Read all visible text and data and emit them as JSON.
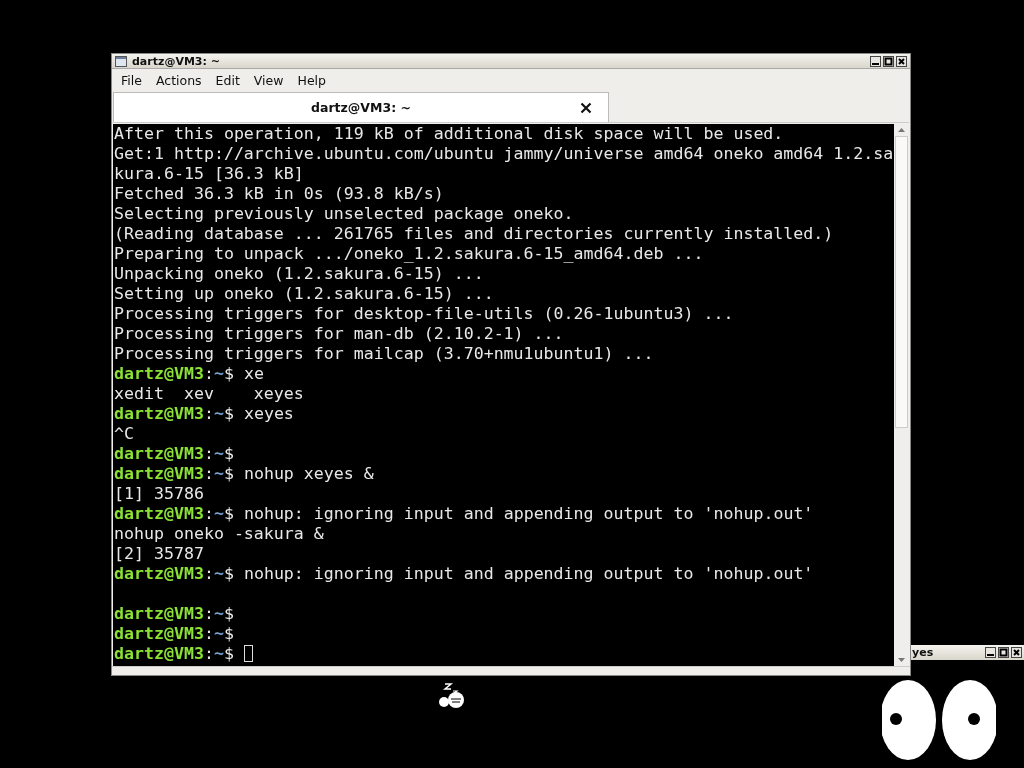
{
  "terminal_window": {
    "title": "dartz@VM3: ~",
    "menu": [
      "File",
      "Actions",
      "Edit",
      "View",
      "Help"
    ],
    "tabs": [
      {
        "label": "dartz@VM3: ~",
        "selected": true
      }
    ],
    "lines": [
      {
        "kind": "output",
        "text": "After this operation, 119 kB of additional disk space will be used."
      },
      {
        "kind": "output",
        "text": "Get:1 http://archive.ubuntu.com/ubuntu jammy/universe amd64 oneko amd64 1.2.sa"
      },
      {
        "kind": "output",
        "text": "kura.6-15 [36.3 kB]"
      },
      {
        "kind": "output",
        "text": "Fetched 36.3 kB in 0s (93.8 kB/s)"
      },
      {
        "kind": "output",
        "text": "Selecting previously unselected package oneko."
      },
      {
        "kind": "output",
        "text": "(Reading database ... 261765 files and directories currently installed.)"
      },
      {
        "kind": "output",
        "text": "Preparing to unpack .../oneko_1.2.sakura.6-15_amd64.deb ..."
      },
      {
        "kind": "output",
        "text": "Unpacking oneko (1.2.sakura.6-15) ..."
      },
      {
        "kind": "output",
        "text": "Setting up oneko (1.2.sakura.6-15) ..."
      },
      {
        "kind": "output",
        "text": "Processing triggers for desktop-file-utils (0.26-1ubuntu3) ..."
      },
      {
        "kind": "output",
        "text": "Processing triggers for man-db (2.10.2-1) ..."
      },
      {
        "kind": "output",
        "text": "Processing triggers for mailcap (3.70+nmu1ubuntu1) ..."
      },
      {
        "kind": "prompt",
        "user": "dartz@VM3",
        "separator": ":",
        "path": "~",
        "sign": "$",
        "command": "xe",
        "cursor": false
      },
      {
        "kind": "output",
        "text": "xedit  xev    xeyes"
      },
      {
        "kind": "prompt",
        "user": "dartz@VM3",
        "separator": ":",
        "path": "~",
        "sign": "$",
        "command": "xeyes",
        "cursor": false
      },
      {
        "kind": "output",
        "text": "^C"
      },
      {
        "kind": "prompt",
        "user": "dartz@VM3",
        "separator": ":",
        "path": "~",
        "sign": "$",
        "cursor": false
      },
      {
        "kind": "prompt",
        "user": "dartz@VM3",
        "separator": ":",
        "path": "~",
        "sign": "$",
        "command": "nohup xeyes &",
        "cursor": false
      },
      {
        "kind": "output",
        "text": "[1] 35786"
      },
      {
        "kind": "prompt",
        "user": "dartz@VM3",
        "separator": ":",
        "path": "~",
        "sign": "$",
        "command": "nohup: ignoring input and appending output to 'nohup.out'",
        "cursor": false
      },
      {
        "kind": "output",
        "text": "nohup oneko -sakura &"
      },
      {
        "kind": "output",
        "text": "[2] 35787"
      },
      {
        "kind": "prompt",
        "user": "dartz@VM3",
        "separator": ":",
        "path": "~",
        "sign": "$",
        "command": "nohup: ignoring input and appending output to 'nohup.out'",
        "cursor": false
      },
      {
        "kind": "blank"
      },
      {
        "kind": "prompt",
        "user": "dartz@VM3",
        "separator": ":",
        "path": "~",
        "sign": "$",
        "cursor": false
      },
      {
        "kind": "prompt",
        "user": "dartz@VM3",
        "separator": ":",
        "path": "~",
        "sign": "$",
        "cursor": false
      },
      {
        "kind": "prompt",
        "user": "dartz@VM3",
        "separator": ":",
        "path": "~",
        "sign": "$",
        "cursor": true
      }
    ]
  },
  "xeyes_window": {
    "title": "yes"
  }
}
